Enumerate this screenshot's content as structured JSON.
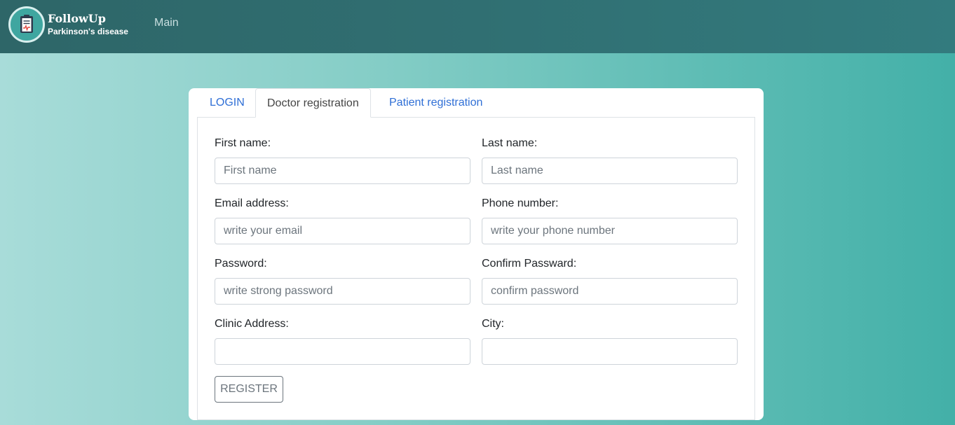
{
  "brand": {
    "title": "FollowUp",
    "subtitle": "Parkinson's disease",
    "icon": "clipboard-icon"
  },
  "nav": {
    "main_label": "Main"
  },
  "tabs": [
    {
      "label": "LOGIN",
      "active": false
    },
    {
      "label": "Doctor registration",
      "active": true
    },
    {
      "label": "Patient registration",
      "active": false
    }
  ],
  "form": {
    "first_name": {
      "label": "First name:",
      "placeholder": "First name",
      "value": ""
    },
    "last_name": {
      "label": "Last name:",
      "placeholder": "Last name",
      "value": ""
    },
    "email": {
      "label": "Email address:",
      "placeholder": "write your email",
      "value": ""
    },
    "phone": {
      "label": "Phone number:",
      "placeholder": "write your phone number",
      "value": ""
    },
    "password": {
      "label": "Password:",
      "placeholder": "write strong password",
      "value": ""
    },
    "confirm_password": {
      "label": "Confirm Passward:",
      "placeholder": "confirm password",
      "value": ""
    },
    "clinic_address": {
      "label": "Clinic Address:",
      "placeholder": "",
      "value": ""
    },
    "city": {
      "label": "City:",
      "placeholder": "",
      "value": ""
    },
    "submit_label": "REGISTER"
  },
  "colors": {
    "navbar": "#306f72",
    "link": "#2f6fd6",
    "background_start": "#a8dcd9",
    "background_end": "#43b0a8"
  }
}
